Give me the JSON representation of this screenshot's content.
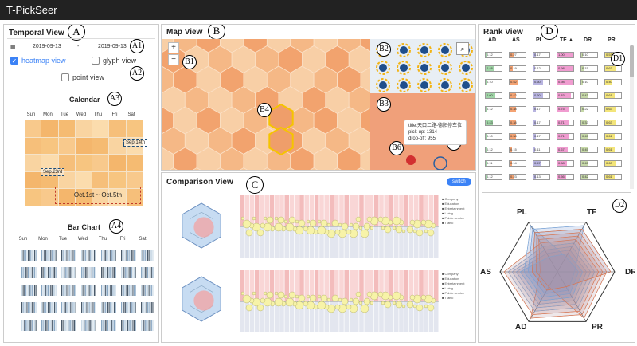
{
  "app": {
    "title": "T-PickSeer"
  },
  "temporal": {
    "title": "Temporal View",
    "tag": "A",
    "start_date": "2019-09-13",
    "separator": "-",
    "end_date": "2019-09-13",
    "date_tag": "A1",
    "views": [
      {
        "label": "heatmap view",
        "checked": true
      },
      {
        "label": "glyph view",
        "checked": false
      },
      {
        "label": "point view",
        "checked": false
      }
    ],
    "views_tag": "A2",
    "calendar": {
      "title": "Calendar",
      "tag": "A3",
      "days": [
        "Sun",
        "Mon",
        "Tue",
        "Wed",
        "Thu",
        "Fri",
        "Sat"
      ],
      "note_sep14": "Sep.14th",
      "note_sep23": "Sep.23rd",
      "note_oct": "Oct.1st ~ Oct.5th"
    },
    "barchart": {
      "title": "Bar Chart",
      "tag": "A4",
      "days": [
        "Sun",
        "Mon",
        "Tue",
        "Wed",
        "Thu",
        "Fri",
        "Sat"
      ]
    }
  },
  "map": {
    "title": "Map View",
    "tag": "B",
    "zoom_in": "+",
    "zoom_out": "−",
    "tags": [
      "B1",
      "B2",
      "B3",
      "B4",
      "B5",
      "B6"
    ],
    "popup": {
      "line1": "title:天口二路-德阳停车位",
      "line2": "pick-up: 1314",
      "line3": "drop-off: 955"
    }
  },
  "comparison": {
    "title": "Comparison View",
    "tag": "C",
    "switch_label": "switch",
    "legend": [
      "Company",
      "Education",
      "Entertainment",
      "Living",
      "Public service",
      "Traffic"
    ]
  },
  "rank": {
    "title": "Rank View",
    "tag": "D",
    "tag_table": "D1",
    "tag_radar": "D2",
    "headers": [
      "AD",
      "AS",
      "PI",
      "TF ▲",
      "DR",
      "PR"
    ],
    "radar_axes": [
      "PL",
      "TF",
      "DR",
      "PR",
      "AD",
      "AS"
    ],
    "colors": {
      "AD": "#9fd4a6",
      "AS": "#f4a373",
      "PI": "#b8b4e0",
      "TF": "#f09cd0",
      "DR": "#c6d8a8",
      "PR": "#f3e57a"
    },
    "rows": [
      [
        "0.12",
        "0.27",
        "0.17",
        "1.00",
        "0.10",
        "0.51"
      ],
      [
        "0.48",
        "0.19",
        "0.12",
        "0.98",
        "0.15",
        "0.63"
      ],
      [
        "0.10",
        "0.52",
        "0.60",
        "0.98",
        "0.10",
        "0.40"
      ],
      [
        "0.60",
        "0.42",
        "0.60",
        "0.83",
        "0.43",
        "0.61"
      ],
      [
        "0.12",
        "0.38",
        "0.17",
        "0.75",
        "0.22",
        "0.63"
      ],
      [
        "0.43",
        "0.38",
        "0.17",
        "0.71",
        "0.33",
        "0.63"
      ],
      [
        "0.10",
        "0.38",
        "0.17",
        "0.71",
        "0.45",
        "0.61"
      ],
      [
        "0.12",
        "0.15",
        "0.11",
        "0.67",
        "0.45",
        "0.61"
      ],
      [
        "0.11",
        "0.14",
        "0.47",
        "0.58",
        "0.45",
        "0.63"
      ],
      [
        "0.12",
        "0.23",
        "0.13",
        "0.56",
        "0.42",
        "0.61"
      ]
    ]
  }
}
